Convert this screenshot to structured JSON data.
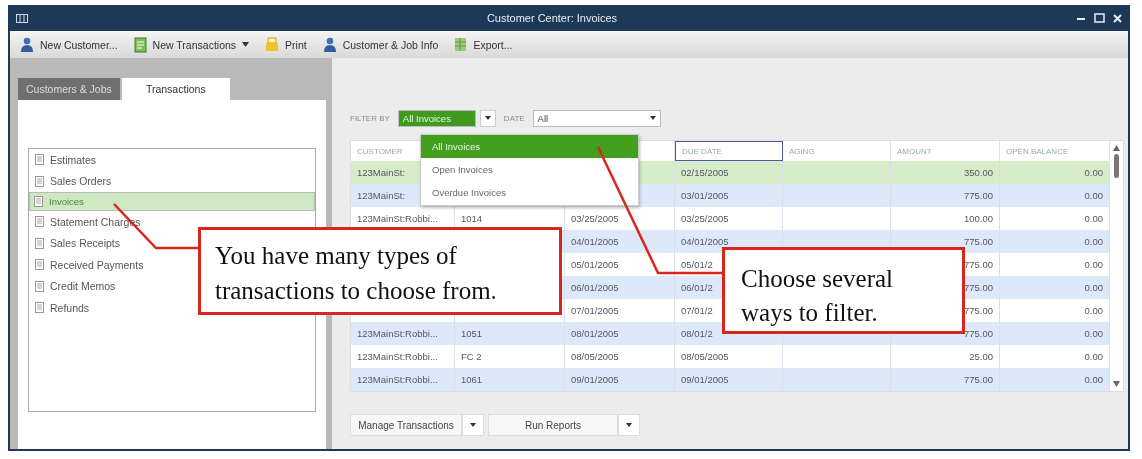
{
  "window": {
    "title": "Customer Center: Invoices"
  },
  "toolbar": [
    {
      "label": "New Customer...",
      "kind": "customer",
      "dropdown": false
    },
    {
      "label": "New Transactions",
      "kind": "document",
      "dropdown": true
    },
    {
      "label": "Print",
      "kind": "printer",
      "dropdown": false
    },
    {
      "label": "Customer & Job Info",
      "kind": "customer",
      "dropdown": false
    },
    {
      "label": "Export...",
      "kind": "spreadsheet",
      "dropdown": false
    }
  ],
  "sidebar": {
    "tabs": [
      {
        "label": "Customers & Jobs",
        "selected": false
      },
      {
        "label": "Transactions",
        "selected": true
      }
    ],
    "items": [
      {
        "label": "Estimates",
        "selected": false
      },
      {
        "label": "Sales Orders",
        "selected": false
      },
      {
        "label": "Invoices",
        "selected": true
      },
      {
        "label": "Statement Charges",
        "selected": false
      },
      {
        "label": "Sales Receipts",
        "selected": false
      },
      {
        "label": "Received Payments",
        "selected": false
      },
      {
        "label": "Credit Memos",
        "selected": false
      },
      {
        "label": "Refunds",
        "selected": false
      }
    ]
  },
  "filters": {
    "filter_by_label": "FILTER BY",
    "filter_by": "All Invoices",
    "date_label": "DATE",
    "date": "All"
  },
  "filter_menu": [
    {
      "label": "All Invoices",
      "selected": true
    },
    {
      "label": "Open Invoices",
      "selected": false
    },
    {
      "label": "Overdue Invoices",
      "selected": false
    }
  ],
  "table": {
    "columns": [
      "CUSTOMER",
      "DUE DATE",
      "AGING",
      "AMOUNT",
      "OPEN BALANCE"
    ],
    "rows": [
      {
        "customer": "123MainSt:",
        "due_date": "02/15/2005",
        "amount": "350.00",
        "open_balance": "0.00",
        "selected": true
      },
      {
        "customer": "123MainSt:",
        "due_date": "03/01/2005",
        "amount": "775.00",
        "open_balance": "0.00",
        "selected": false
      },
      {
        "customer": "123MainSt:Robbi...",
        "num": "1014",
        "date": "03/25/2005",
        "due_date": "03/25/2005",
        "amount": "100.00",
        "open_balance": "0.00",
        "selected": false
      },
      {
        "date": "04/01/2005",
        "due_date": "04/01/2005",
        "amount": "775.00",
        "open_balance": "0.00",
        "selected": false
      },
      {
        "date": "05/01/2005",
        "due_date": "05/01/2",
        "amount": "775.00",
        "open_balance": "0.00",
        "selected": false
      },
      {
        "date": "06/01/2005",
        "due_date": "06/01/2",
        "amount": "775.00",
        "open_balance": "0.00",
        "selected": false
      },
      {
        "date": "07/01/2005",
        "due_date": "07/01/2",
        "amount": "775.00",
        "open_balance": "0.00",
        "selected": false
      },
      {
        "customer": "123MainSt:Robbi...",
        "num": "1051",
        "date": "08/01/2005",
        "due_date": "08/01/2",
        "amount": "775.00",
        "open_balance": "0.00",
        "selected": false
      },
      {
        "customer": "123MainSt:Robbi...",
        "num": "FC 2",
        "date": "08/05/2005",
        "due_date": "08/05/2005",
        "amount": "25.00",
        "open_balance": "0.00",
        "selected": false
      },
      {
        "customer": "123MainSt:Robbi...",
        "num": "1061",
        "date": "09/01/2005",
        "due_date": "09/01/2005",
        "amount": "775.00",
        "open_balance": "0.00",
        "selected": false
      }
    ]
  },
  "actions": [
    {
      "label": "Manage Transactions"
    },
    {
      "label": "Run Reports"
    }
  ],
  "callouts": [
    "You have many types of transactions to choose from.",
    "Choose several ways to filter."
  ]
}
